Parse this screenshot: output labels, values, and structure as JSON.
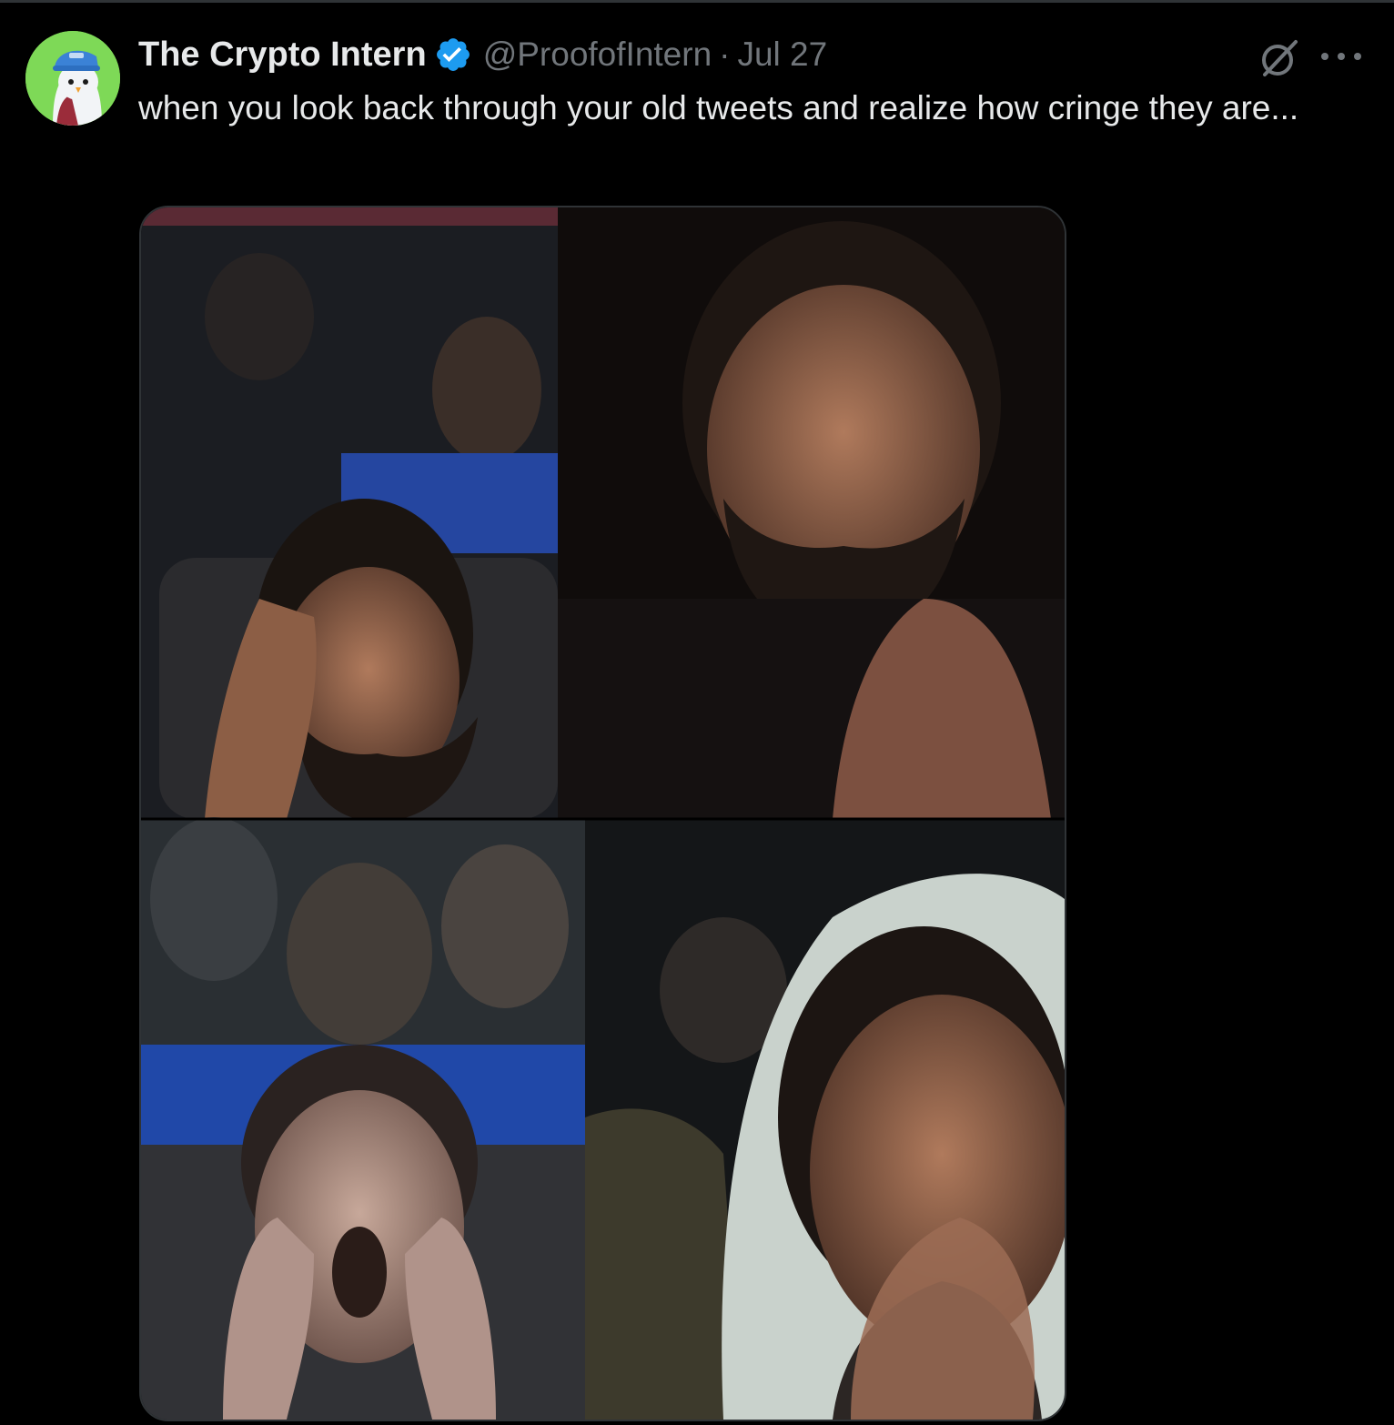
{
  "tweet": {
    "author_name": "The Crypto Intern",
    "handle": "@ProofofIntern",
    "separator": "·",
    "date": "Jul 27",
    "text": "when you look back through your old tweets and realize how cringe they are..."
  },
  "icons": {
    "avatar": "penguin-avatar",
    "verified": "verified-badge-icon",
    "grok": "grok-icon",
    "more": "more-options-icon"
  },
  "colors": {
    "background": "#000000",
    "primary_text": "#e7e9ea",
    "secondary_text": "#71767b",
    "verified_blue": "#1d9bf0",
    "avatar_bg": "#7ed957",
    "border": "#2f3336"
  },
  "media": {
    "count": 4,
    "panels": [
      "panel-top-left",
      "panel-top-right",
      "panel-bottom-left",
      "panel-bottom-right"
    ]
  }
}
